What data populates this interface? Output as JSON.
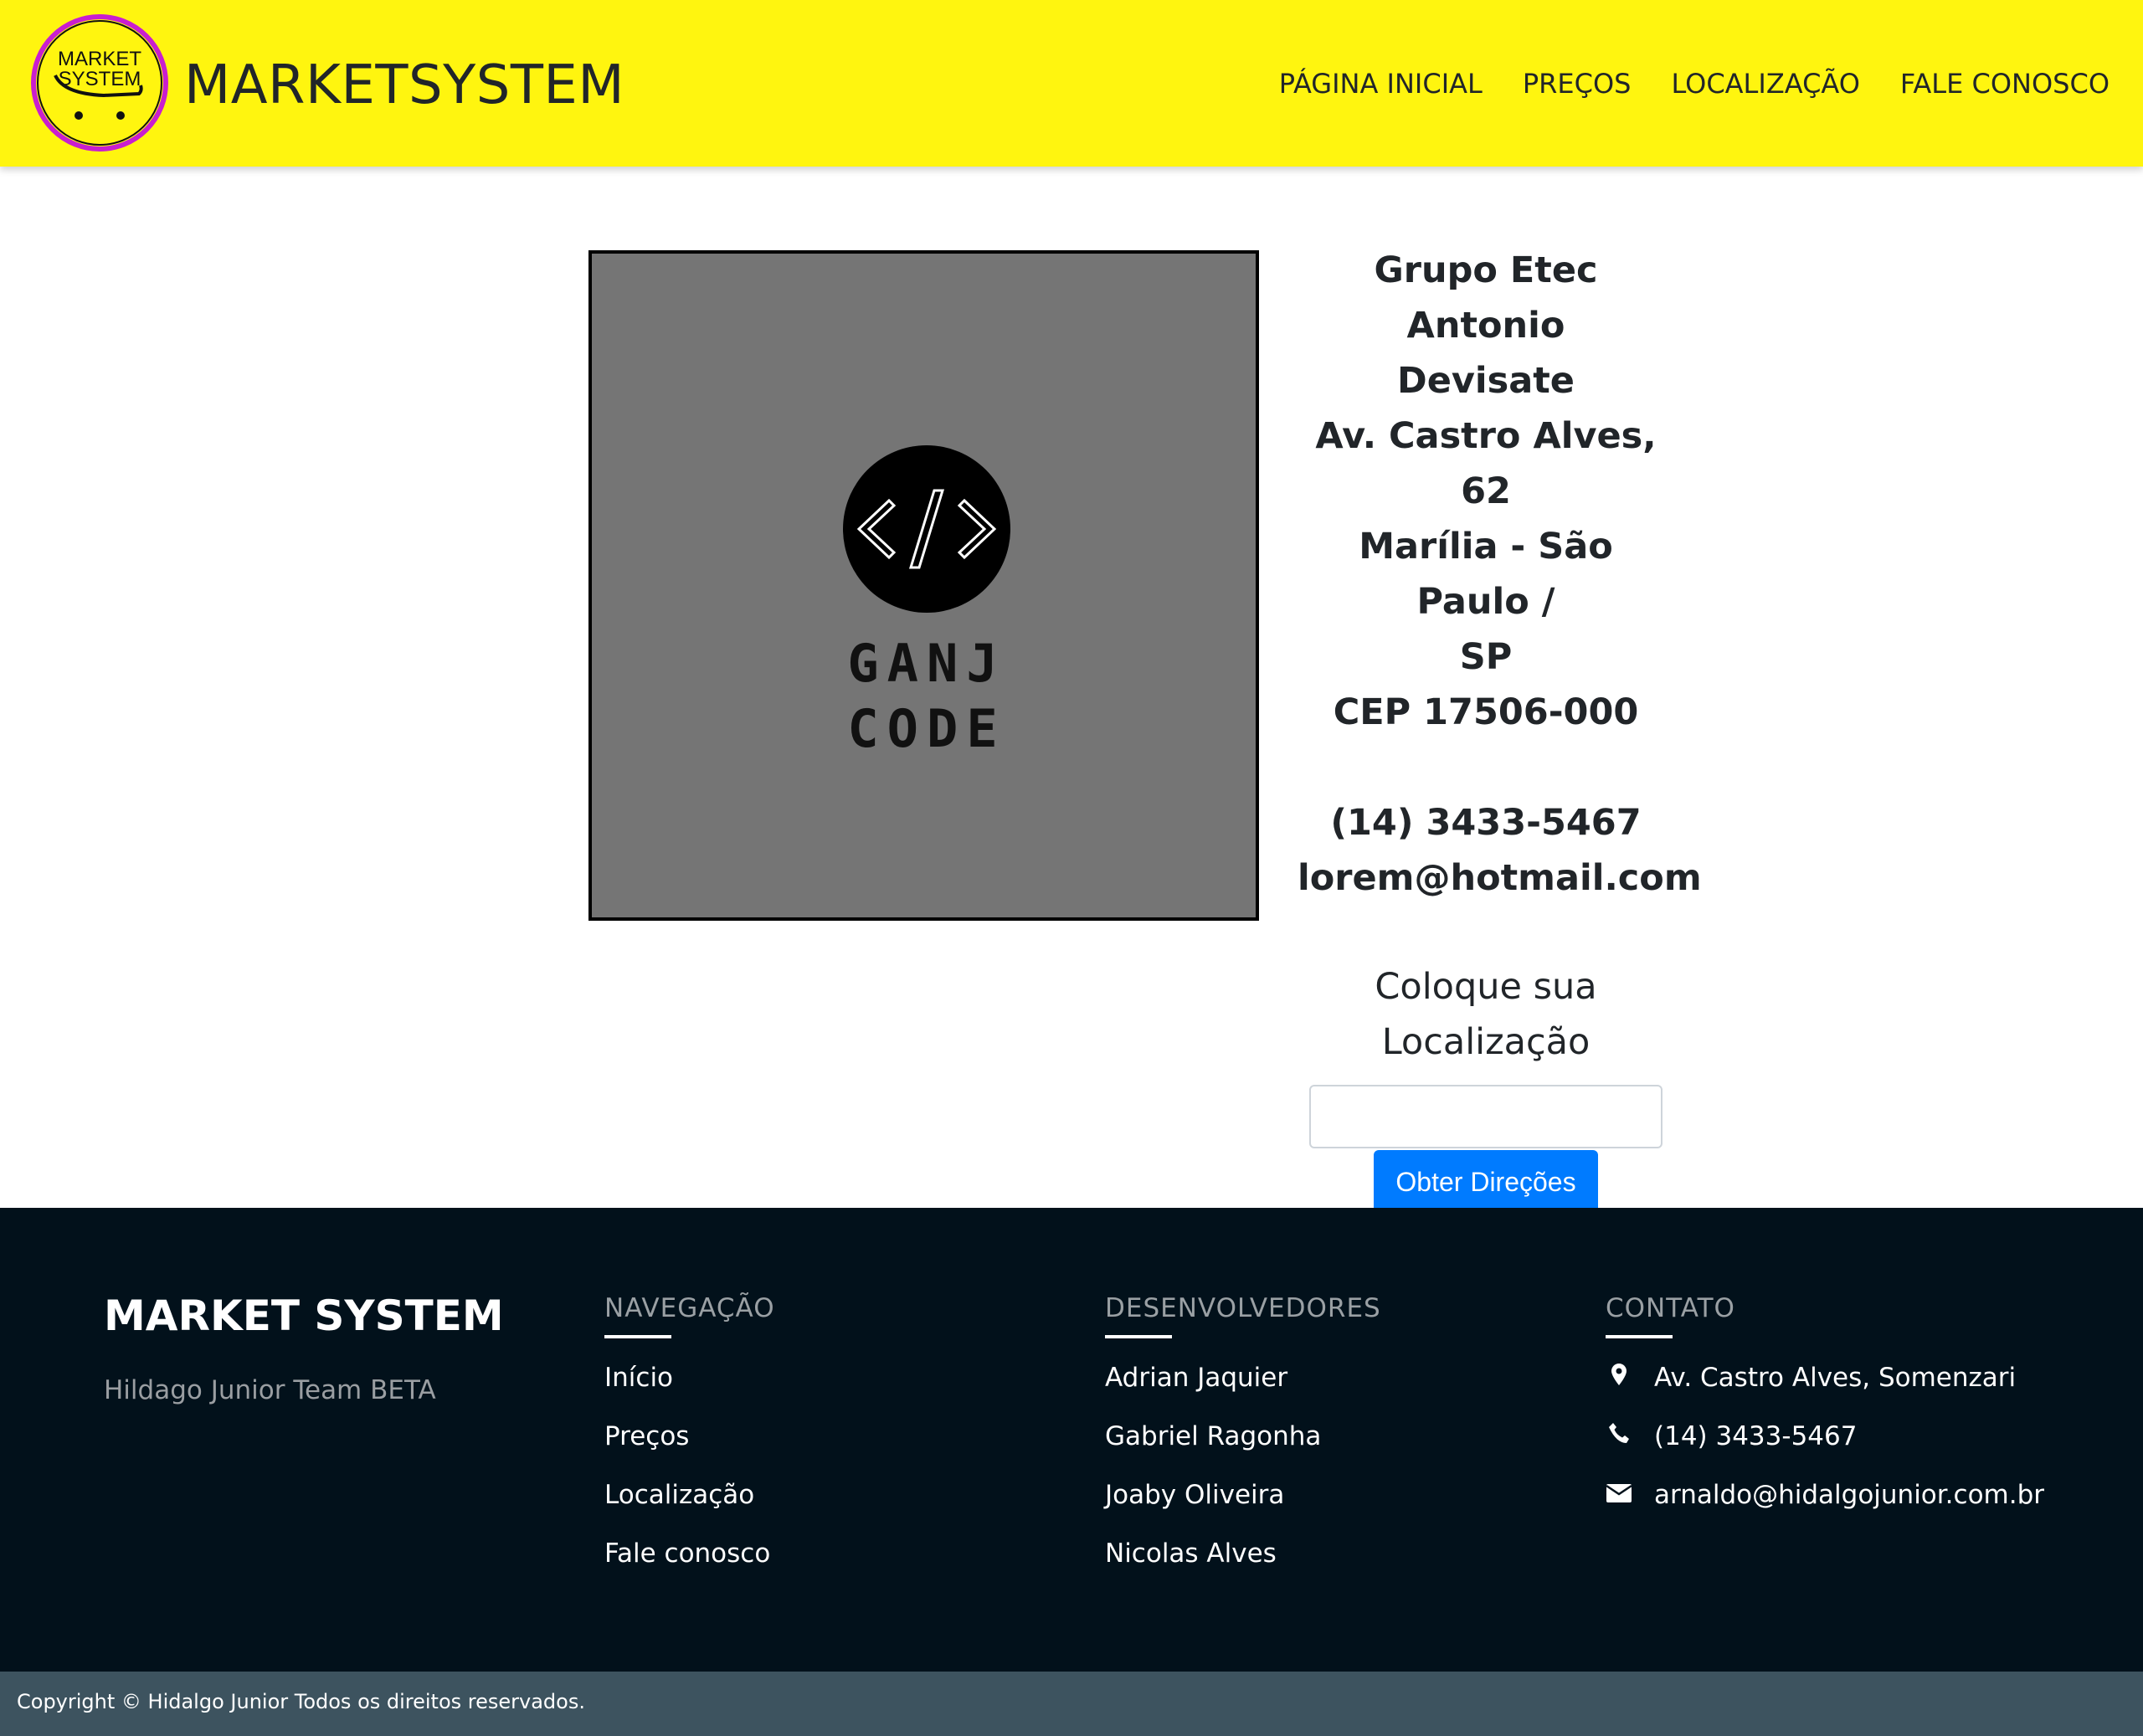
{
  "header": {
    "logo_text_line1": "MARKET",
    "logo_text_line2": "SYSTEM",
    "brand": "MARKETSYSTEM",
    "nav": [
      "PÁGINA INICIAL",
      "PREÇOS",
      "LOCALIZAÇÃO",
      "FALE CONOSCO"
    ]
  },
  "map": {
    "logo_line1": "GANJ",
    "logo_line2": "CODE",
    "logo_symbol": "</>"
  },
  "info": {
    "address_lines": [
      "Grupo Etec Antonio",
      "Devisate",
      "Av. Castro Alves, 62",
      "Marília - São Paulo /",
      "SP",
      "CEP 17506-000"
    ],
    "phone": "(14) 3433-5467",
    "email": "lorem@hotmail.com",
    "location_label_line1": "Coloque sua",
    "location_label_line2": "Localização",
    "location_input_value": "",
    "directions_button": "Obter Direções"
  },
  "footer": {
    "title": "MARKET SYSTEM",
    "subtitle": "Hildago Junior Team BETA",
    "navigation": {
      "heading": "NAVEGAÇÃO",
      "items": [
        "Início",
        "Preços",
        "Localização",
        "Fale conosco"
      ]
    },
    "developers": {
      "heading": "DESENVOLVEDORES",
      "items": [
        "Adrian Jaquier",
        "Gabriel Ragonha",
        "Joaby Oliveira",
        "Nicolas Alves"
      ]
    },
    "contact": {
      "heading": "CONTATO",
      "items": [
        {
          "icon": "map-marker-icon",
          "text": "Av. Castro Alves, Somenzari"
        },
        {
          "icon": "phone-icon",
          "text": "(14) 3433-5467"
        },
        {
          "icon": "envelope-icon",
          "text": "arnaldo@hidalgojunior.com.br"
        }
      ]
    }
  },
  "copyright": "Copyright © Hidalgo Junior Todos os direitos reservados.",
  "colors": {
    "header_bg": "#fff50f",
    "footer_bg": "#02111b",
    "copyright_bg": "#3d535f",
    "button_bg": "#007bff",
    "logo_ring": "#c91ecf"
  }
}
